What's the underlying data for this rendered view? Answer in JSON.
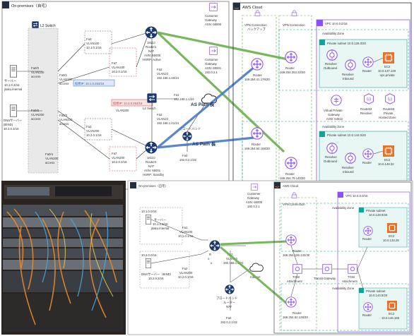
{
  "colors": {
    "aws_orange": "#e8722b",
    "vpc_purple": "#8c4fff",
    "router_purple": "#9c27b0",
    "green_link": "#6ab04c",
    "blue_link": "#4a78c8",
    "aws_dark": "#232f3e",
    "subnet_teal": "#12a39b",
    "router_blue": "#1b3a6b"
  },
  "top": {
    "onprem_title": "On-premises（自宅）",
    "l2_switch_label": "L2 Switch",
    "server1": {
      "name": "サーバー",
      "ip": "10.1.0.3/16",
      "host": "jitaku.internal"
    },
    "server2": {
      "name": "DNSサーバー",
      "sub": "(BIND)",
      "ip": "10.2.0.3/16"
    },
    "ports": {
      "fa0_0": [
        "Fa0/0",
        "VLAN100",
        "access"
      ],
      "fa0_1": [
        "Fa0/1",
        "VLAN100",
        "access"
      ],
      "fa0_2": [
        "Fa0/2",
        "VLAN200",
        "access"
      ],
      "fa0_3": [
        "Fa0/3",
        "VLAN100",
        "access"
      ],
      "fa0_4": [
        "Fa0/4",
        "VLAN200",
        "access"
      ],
      "fa3_top": [
        "Fa3",
        "VLAN100",
        "10.1.0.1/16"
      ],
      "fa3_bottom": [
        "Fa3",
        "VLAN200",
        "10.2.0.1/16"
      ],
      "fa7_r1": [
        "Fa7",
        "VLAN100",
        "10.2.0.1/16"
      ],
      "fa7_r2": [
        "Fa7",
        "VLAN200",
        "10.2.0.2/16"
      ],
      "fa2_r1": [
        "Fa2",
        "VLAN10",
        "192.168.1.40/24"
      ],
      "fa2_r2": [
        "Fa2",
        "VLAN10",
        "192.168.1.41/24"
      ],
      "fa1_r1": [
        "Fa1",
        "192.168.1.1/24"
      ],
      "fa0_r2": [
        "Fa0",
        "192.0.2.1/32"
      ]
    },
    "vip_blue": "仮想IP: 10.1.0.254/16",
    "vip_red": "仮想IP: 10.2.0.254/16",
    "vlan200_mid": "VLAN200",
    "router1": [
      "1812J",
      "Router1",
      "NAT",
      "ASN: 65000",
      "HSRP: Active"
    ],
    "router2": [
      "1812J",
      "Router2",
      "NAT",
      "ASN: 65001",
      "HSRP: Standby"
    ],
    "l2_switch_mid": "L2 Switch",
    "broadband": "ブロードバンド",
    "broadband_nat": "NAT",
    "as_path": "AS Path 長",
    "cgw1": [
      "Customer",
      "Gateway",
      "ASN: 65000"
    ],
    "cgw2": [
      "Customer",
      "Gateway",
      "ASN: 65001",
      "192.0.2.1"
    ],
    "aws_cloud": "AWS Cloud",
    "vpn_backup": "VPN Connection",
    "vpn_backup_sub": "バックアップ",
    "vpn_conn": "VPN Connection",
    "vpn_router_a": [
      "Router",
      "169.254.253.32/30"
    ],
    "vpn_router_b": [
      "Router",
      "169.254.41.176/30"
    ],
    "vpn_router_c": [
      "Router",
      "169.254.64.168/30"
    ],
    "vpn_router_d": [
      "Router",
      "169.254.79.140/30"
    ],
    "vpc": "VPC 10.0.0.0/16",
    "az": "Availability Zone",
    "subnet1": "Private subnet 10.0.128.0/20",
    "subnet2": "Private subnet 10.0.144.0/20",
    "resolver_out": [
      "Resolver",
      "Outbound"
    ],
    "resolver_in": [
      "Resolver",
      "Inbound"
    ],
    "router": "Router",
    "ec2_1": [
      "EC2",
      "10.0.137.130",
      "vpc.private"
    ],
    "ec2_2": [
      "EC2",
      "10.0.148.32"
    ],
    "vpg": [
      "Virtual Private",
      "Gateway",
      "ASN: 64512"
    ],
    "r53_resolver": [
      "Route53",
      "Resolver"
    ],
    "r53_zone": [
      "Route53",
      "Private",
      "Hosted Zone"
    ]
  },
  "bottom": {
    "onprem_title": "On-premises（自宅）",
    "net1": "10.1.0.0/16",
    "net2": "10.2.0.0/16",
    "server1": [
      "サーバー",
      "10.1.0.3/16",
      "jitaku.internal"
    ],
    "server2": [
      "DNSサーバー（BIND）",
      "10.2.0.3/16"
    ],
    "fa1": [
      "Fa1",
      "VLAN100",
      "10.1.0.1/16"
    ],
    "fa2": [
      "Fa2",
      "VLAN200",
      "10.2.0.1/16"
    ],
    "router": "Router",
    "fa2_up": [
      "Fa2",
      "VLAN10",
      "192.168.1.1/24"
    ],
    "broadband": [
      "ブロードバンド",
      "ルーター",
      "NAT"
    ],
    "fa0": [
      "Fa0",
      "192.0.2.1/32"
    ],
    "cgw": [
      "Customer",
      "Gateway",
      "ASN: 65000",
      "192.0.2.1"
    ],
    "internet": "Internet",
    "aws_cloud": "AWS Cloud",
    "vpn": "VPN Connection",
    "vpc": "VPC 10.0.0.0/16",
    "az": "Availability Zone",
    "router_a": [
      "Router",
      "169.254.106.132/30"
    ],
    "router_b": [
      "Router",
      "169.254.62.128/30"
    ],
    "tgw1": [
      "TGW",
      "Attachment"
    ],
    "tgw": "Transit Gateway",
    "tgw2": [
      "TGW",
      "Attachment"
    ],
    "subnet1": [
      "Private subnet",
      "10.0.128.0/20"
    ],
    "subnet2": [
      "Private subnet",
      "10.0.144.0/20"
    ],
    "ec2_1": [
      "EC2",
      "10.0.133.28"
    ],
    "ec2_2": [
      "EC2",
      "10.0.146.185"
    ]
  }
}
